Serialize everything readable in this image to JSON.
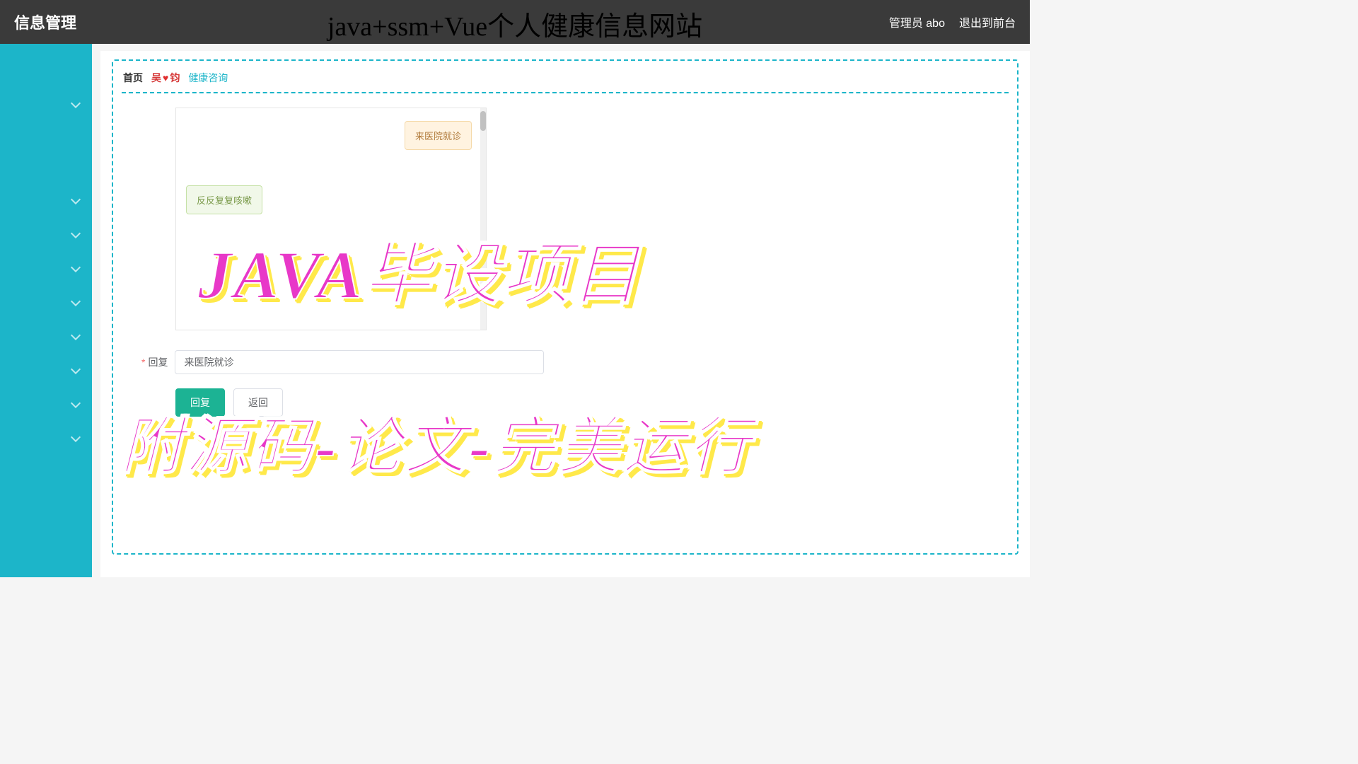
{
  "header": {
    "left_title": "信息管理",
    "admin_label": "管理员 abo",
    "logout_label": "退出到前台"
  },
  "title_overlay": "java+ssm+Vue个人健康信息网站",
  "breadcrumb": {
    "home": "首页",
    "user_prefix": "吴",
    "user_suffix": "钧",
    "current": "健康咨询"
  },
  "chat": {
    "msg_right": "来医院就诊",
    "msg_left": "反反复复咳嗽"
  },
  "form": {
    "label": "回复",
    "value": "来医院就诊"
  },
  "buttons": {
    "reply": "回复",
    "back": "返回"
  },
  "promo": {
    "line1": "JAVA毕设项目",
    "line2": "附源码-论文-完美运行"
  },
  "sidebar": {
    "item_count": 9
  }
}
